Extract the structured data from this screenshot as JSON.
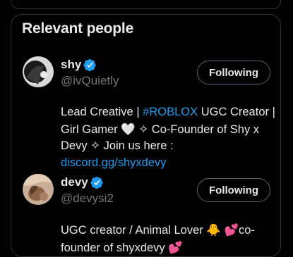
{
  "section": {
    "title": "Relevant people"
  },
  "people": [
    {
      "name": "shy",
      "handle": "@ivQuietly",
      "follow_label": "Following",
      "bio": {
        "t1": "Lead Creative | ",
        "link1": "#ROBLOX",
        "t2": " UGC Creator | Girl Gamer ",
        "e1": "🤍",
        "t3": " ✧ Co-Founder of Shy x Devy ✧ Join us here : ",
        "link2": "discord.gg/shyxdevy"
      }
    },
    {
      "name": "devy",
      "handle": "@devysi2",
      "follow_label": "Following",
      "bio": {
        "t1": "UGC creator / Animal Lover ",
        "e1": "🐥",
        "e2": "💕",
        "t2": "co-founder of shyxdevy ",
        "e3": "💕"
      }
    }
  ],
  "colors": {
    "background": "#000000",
    "border": "#2f3336",
    "text": "#e7e9ea",
    "muted": "#71767b",
    "link": "#1d9bf0",
    "verified": "#1d9bf0"
  },
  "icons": {
    "verified": "verified-badge-icon"
  }
}
